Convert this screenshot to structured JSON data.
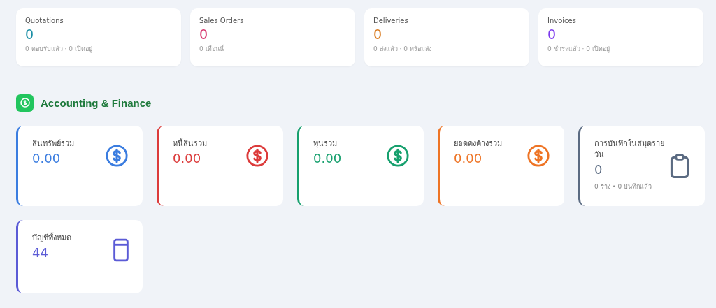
{
  "summary_cards": [
    {
      "title": "Quotations",
      "value": "0",
      "note": "0 ตอบรับแล้ว · 0 เปิดอยู่",
      "color": "#1b8fa6"
    },
    {
      "title": "Sales Orders",
      "value": "0",
      "note": "0 เดือนนี้",
      "color": "#d6336c"
    },
    {
      "title": "Deliveries",
      "value": "0",
      "note": "0 ส่งแล้ว · 0 พร้อมส่ง",
      "color": "#d97a1e"
    },
    {
      "title": "Invoices",
      "value": "0",
      "note": "0 ชำระแล้ว · 0 เปิดอยู่",
      "color": "#7c3aed"
    }
  ],
  "section": {
    "title": "Accounting & Finance"
  },
  "finance_cards": [
    {
      "title": "สินทรัพย์รวม",
      "value": "0.00",
      "color": "#3b7de0",
      "kind": "dollar"
    },
    {
      "title": "หนี้สินรวม",
      "value": "0.00",
      "color": "#dc3b3b",
      "kind": "dollar"
    },
    {
      "title": "ทุนรวม",
      "value": "0.00",
      "color": "#17a06e",
      "kind": "dollar"
    },
    {
      "title": "ยอดคงค้างรวม",
      "value": "0.00",
      "color": "#ee7425",
      "kind": "dollar"
    },
    {
      "title": "การบันทึกในสมุดรายวัน",
      "value": "0",
      "note": "0 ร่าง • 0 บันทึกแล้ว",
      "color": "#5b6b82",
      "kind": "clipboard"
    },
    {
      "title": "บัญชีทั้งหมด",
      "value": "44",
      "color": "#5b5bd6",
      "kind": "book"
    }
  ]
}
